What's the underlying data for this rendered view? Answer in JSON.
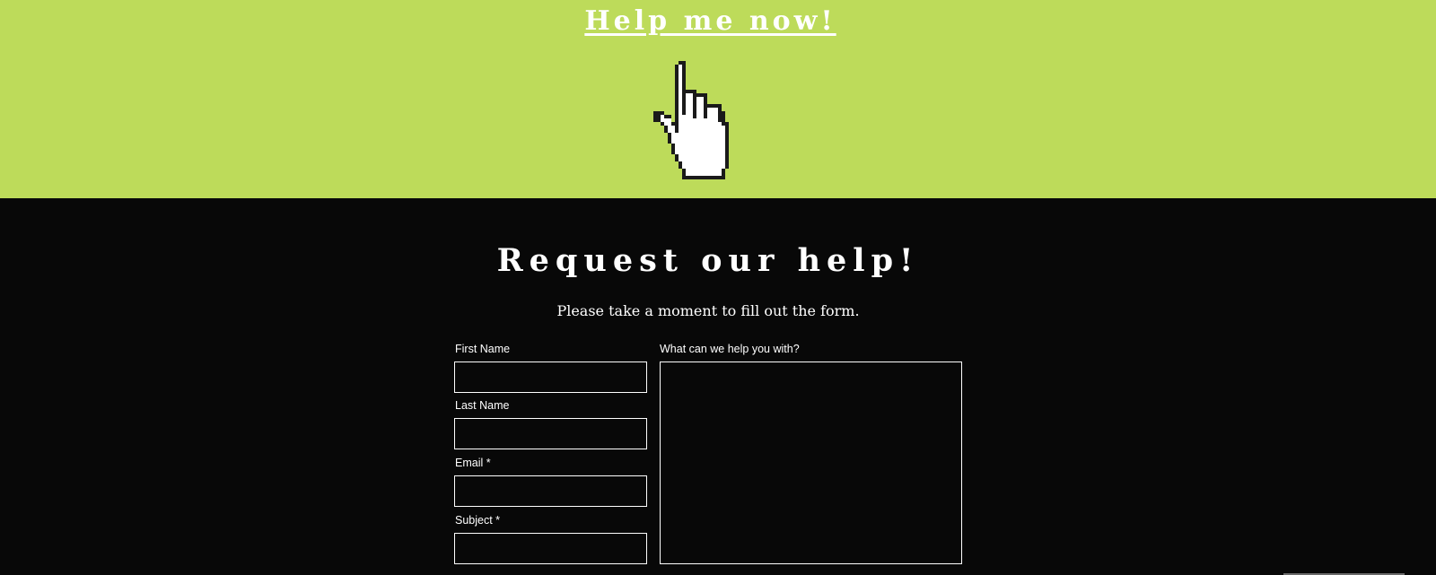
{
  "header": {
    "help_link": "Help me now!",
    "cursor_icon": "hand-pointer-icon"
  },
  "form_section": {
    "title": "Request our help!",
    "subtitle": "Please take a moment to fill out the form."
  },
  "form": {
    "first_name": {
      "label": "First Name",
      "value": "",
      "placeholder": ""
    },
    "last_name": {
      "label": "Last Name",
      "value": "",
      "placeholder": ""
    },
    "email": {
      "label": "Email *",
      "value": "",
      "placeholder": ""
    },
    "subject": {
      "label": "Subject *",
      "value": "",
      "placeholder": ""
    },
    "message": {
      "label": "What can we help you with?",
      "value": "",
      "placeholder": ""
    }
  },
  "colors": {
    "top_band": "#bddb5a",
    "page_background": "#080808",
    "text": "#ffffff",
    "field_border": "#ffffff"
  }
}
